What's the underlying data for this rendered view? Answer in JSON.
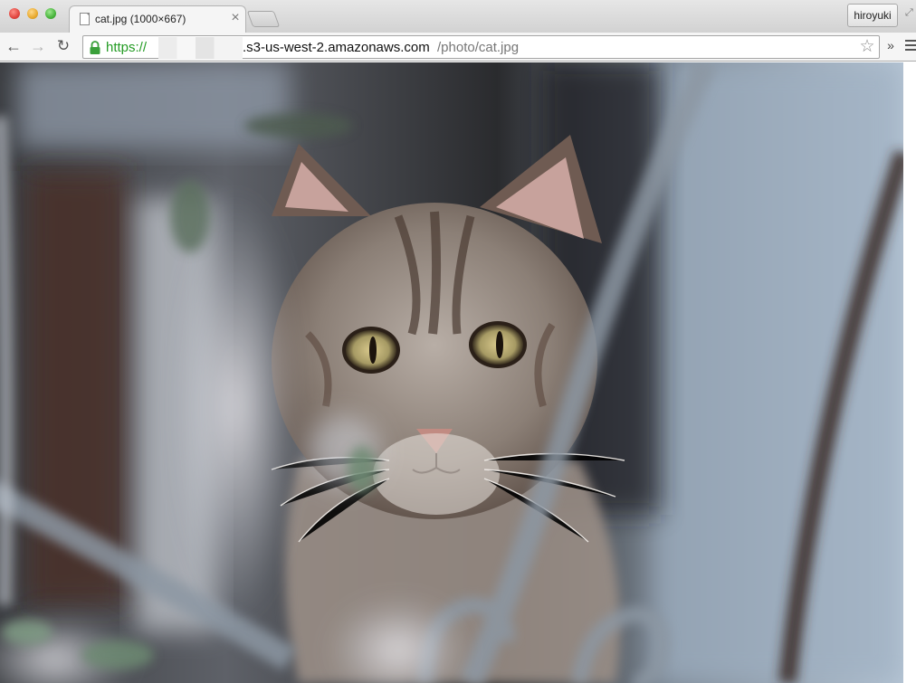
{
  "browser": {
    "tab": {
      "title": "cat.jpg (1000×667)",
      "close_glyph": "×",
      "favicon_icon": "document-icon"
    },
    "profile_name": "hiroyuki",
    "toolbar": {
      "back_glyph": "←",
      "forward_glyph": "→",
      "reload_glyph": "↻",
      "star_glyph": "☆",
      "overflow_glyph": "»"
    },
    "address": {
      "scheme": "https://",
      "host": ".s3-us-west-2.amazonaws.com",
      "path": "/photo/cat.jpg",
      "scheme_color": "#239b23"
    }
  },
  "content": {
    "image_subject": "tabby-kitten-photo"
  }
}
